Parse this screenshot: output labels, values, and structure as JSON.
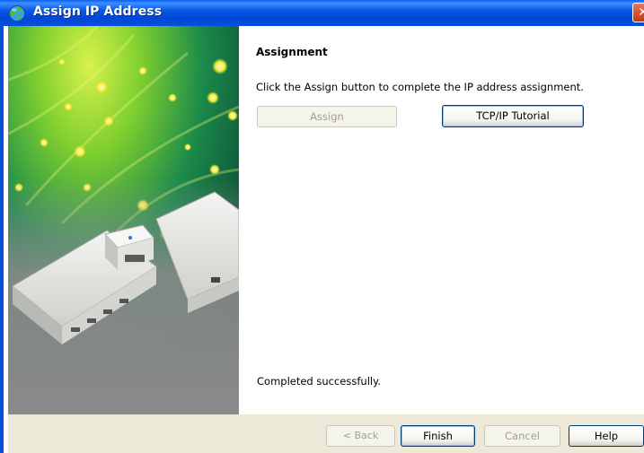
{
  "window": {
    "title": "Assign IP Address",
    "title_icon": "globe-network-icon",
    "close_icon": "close-icon",
    "close_glyph": "✕"
  },
  "page": {
    "heading": "Assignment",
    "instruction": "Click the Assign button to complete the IP address assignment.",
    "assign_label": "Assign",
    "assign_enabled": false,
    "tutorial_label": "TCP/IP Tutorial",
    "status_text": "Completed successfully."
  },
  "footer": {
    "back_label": "< Back",
    "back_enabled": false,
    "finish_label": "Finish",
    "cancel_label": "Cancel",
    "cancel_enabled": false,
    "help_label": "Help"
  },
  "side_image": {
    "description_icon": "network-device-servers-illustration"
  },
  "colors": {
    "titlebar": "#0a59e6",
    "dialog_face": "#ece9d8",
    "close_button": "#d95a35",
    "disabled_text": "#a19f91"
  }
}
